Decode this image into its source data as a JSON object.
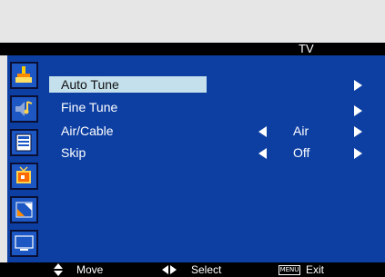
{
  "header": {
    "title": "TV"
  },
  "menu": {
    "items": [
      {
        "label": "Auto Tune",
        "value": "",
        "selected": true
      },
      {
        "label": "Fine Tune",
        "value": ""
      },
      {
        "label": "Air/Cable",
        "value": "Air"
      },
      {
        "label": "Skip",
        "value": "Off"
      }
    ]
  },
  "sidebar": {
    "icons": [
      "picture-icon",
      "sound-icon",
      "setup-icon",
      "tv-icon",
      "display-icon",
      "screen-icon"
    ]
  },
  "footer": {
    "move_label": "Move",
    "select_label": "Select",
    "menu_key": "MENU",
    "exit_label": "Exit"
  },
  "colors": {
    "menu_background": "#0d3fa3",
    "selection_highlight": "#c4e0ec",
    "bar_background": "#000000",
    "screen_background": "#e6e6e6"
  }
}
